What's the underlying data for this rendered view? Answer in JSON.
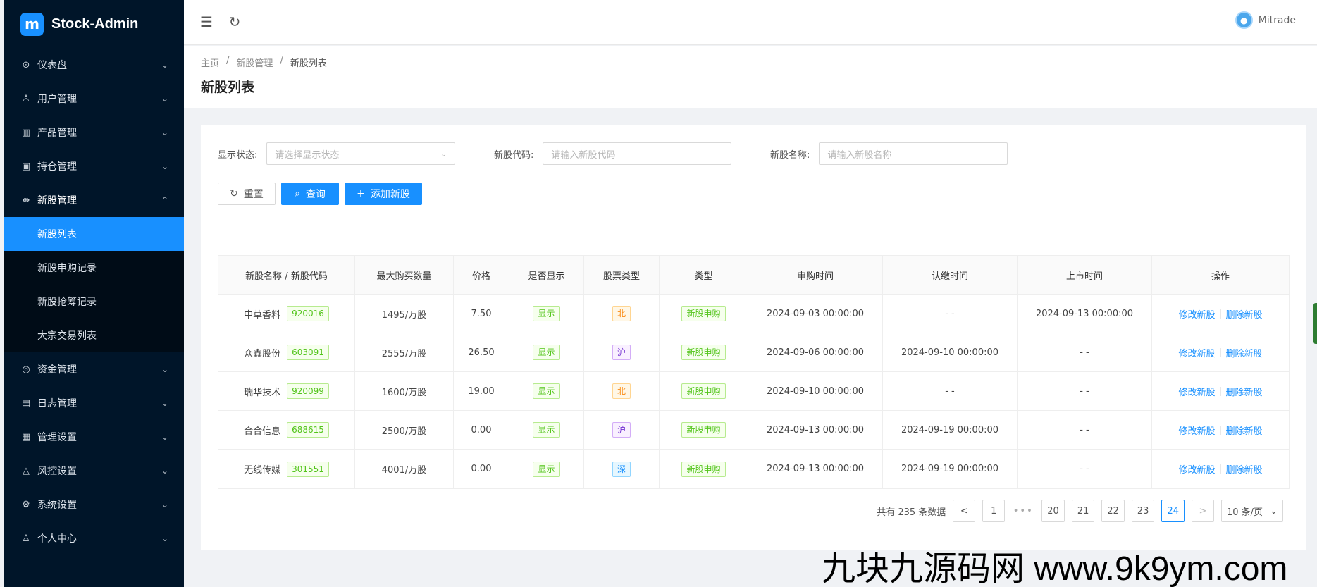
{
  "app": {
    "title": "Stock-Admin",
    "logo_text": "m"
  },
  "sidebar": {
    "items": [
      {
        "label": "仪表盘",
        "icon": "dashboard-icon",
        "glyph": "⊙",
        "arrow": "⌄"
      },
      {
        "label": "用户管理",
        "icon": "user-manage-icon",
        "glyph": "♙",
        "arrow": "⌄"
      },
      {
        "label": "产品管理",
        "icon": "chart-icon",
        "glyph": "▥",
        "arrow": "⌄"
      },
      {
        "label": "持仓管理",
        "icon": "position-icon",
        "glyph": "▣",
        "arrow": "⌄"
      },
      {
        "label": "新股管理",
        "icon": "ipo-icon",
        "glyph": "⇹",
        "arrow": "⌃"
      }
    ],
    "submenu": [
      {
        "label": "新股列表"
      },
      {
        "label": "新股申购记录"
      },
      {
        "label": "新股抢筹记录"
      },
      {
        "label": "大宗交易列表"
      }
    ],
    "after": [
      {
        "label": "资金管理",
        "icon": "money-icon",
        "glyph": "◎",
        "arrow": "⌄"
      },
      {
        "label": "日志管理",
        "icon": "log-icon",
        "glyph": "▤",
        "arrow": "⌄"
      },
      {
        "label": "管理设置",
        "icon": "settings-panel-icon",
        "glyph": "▦",
        "arrow": "⌄"
      },
      {
        "label": "风控设置",
        "icon": "warning-icon",
        "glyph": "△",
        "arrow": "⌄"
      },
      {
        "label": "系统设置",
        "icon": "gear-icon",
        "glyph": "⚙",
        "arrow": "⌄"
      },
      {
        "label": "个人中心",
        "icon": "person-icon",
        "glyph": "♙",
        "arrow": "⌄"
      }
    ]
  },
  "topbar": {
    "collapse_icon": "☰",
    "refresh_icon": "↻",
    "user_name": "Mitrade",
    "avatar_glyph": "●"
  },
  "breadcrumb": {
    "home": "主页",
    "parent": "新股管理",
    "current": "新股列表",
    "sep": "/"
  },
  "page": {
    "title": "新股列表"
  },
  "filters": {
    "status_label": "显示状态:",
    "status_placeholder": "请选择显示状态",
    "status_arrow": "⌄",
    "code_label": "新股代码:",
    "code_placeholder": "请输入新股代码",
    "name_label": "新股名称:",
    "name_placeholder": "请输入新股名称"
  },
  "buttons": {
    "reset": "重置",
    "reset_icon": "↻",
    "search": "查询",
    "search_icon": "⌕",
    "add": "添加新股",
    "add_icon": "+"
  },
  "table": {
    "headers": [
      "新股名称 / 新股代码",
      "最大购买数量",
      "价格",
      "是否显示",
      "股票类型",
      "类型",
      "申购时间",
      "认缴时间",
      "上市时间",
      "操作"
    ],
    "rows": [
      {
        "name": "中草香料",
        "code": "920016",
        "max": "1495/万股",
        "price": "7.50",
        "display": "显示",
        "market": "北",
        "market_tag": "tag-orange",
        "type": "新股申购",
        "apply": "2024-09-03 00:00:00",
        "subscribe": "- -",
        "listing": "2024-09-13 00:00:00",
        "edit": "修改新股",
        "delete": "删除新股"
      },
      {
        "name": "众鑫股份",
        "code": "603091",
        "max": "2555/万股",
        "price": "26.50",
        "display": "显示",
        "market": "沪",
        "market_tag": "tag-purple",
        "type": "新股申购",
        "apply": "2024-09-06 00:00:00",
        "subscribe": "2024-09-10 00:00:00",
        "listing": "- -",
        "edit": "修改新股",
        "delete": "删除新股"
      },
      {
        "name": "瑞华技术",
        "code": "920099",
        "max": "1600/万股",
        "price": "19.00",
        "display": "显示",
        "market": "北",
        "market_tag": "tag-orange",
        "type": "新股申购",
        "apply": "2024-09-10 00:00:00",
        "subscribe": "- -",
        "listing": "- -",
        "edit": "修改新股",
        "delete": "删除新股"
      },
      {
        "name": "合合信息",
        "code": "688615",
        "max": "2500/万股",
        "price": "0.00",
        "display": "显示",
        "market": "沪",
        "market_tag": "tag-purple",
        "type": "新股申购",
        "apply": "2024-09-13 00:00:00",
        "subscribe": "2024-09-19 00:00:00",
        "listing": "- -",
        "edit": "修改新股",
        "delete": "删除新股"
      },
      {
        "name": "无线传媒",
        "code": "301551",
        "max": "4001/万股",
        "price": "0.00",
        "display": "显示",
        "market": "深",
        "market_tag": "tag-cyan",
        "type": "新股申购",
        "apply": "2024-09-13 00:00:00",
        "subscribe": "2024-09-19 00:00:00",
        "listing": "- -",
        "edit": "修改新股",
        "delete": "删除新股"
      }
    ]
  },
  "pagination": {
    "total": "共有 235 条数据",
    "prev": "<",
    "pages": [
      "1",
      "•••",
      "20",
      "21",
      "22",
      "23",
      "24"
    ],
    "current": "24",
    "next": ">",
    "page_size": "10 条/页",
    "page_size_arrow": "⌄"
  },
  "watermark": "九块九源码网 www.9k9ym.com",
  "colors": {
    "sidebar": "#001529",
    "accent": "#1890ff"
  }
}
